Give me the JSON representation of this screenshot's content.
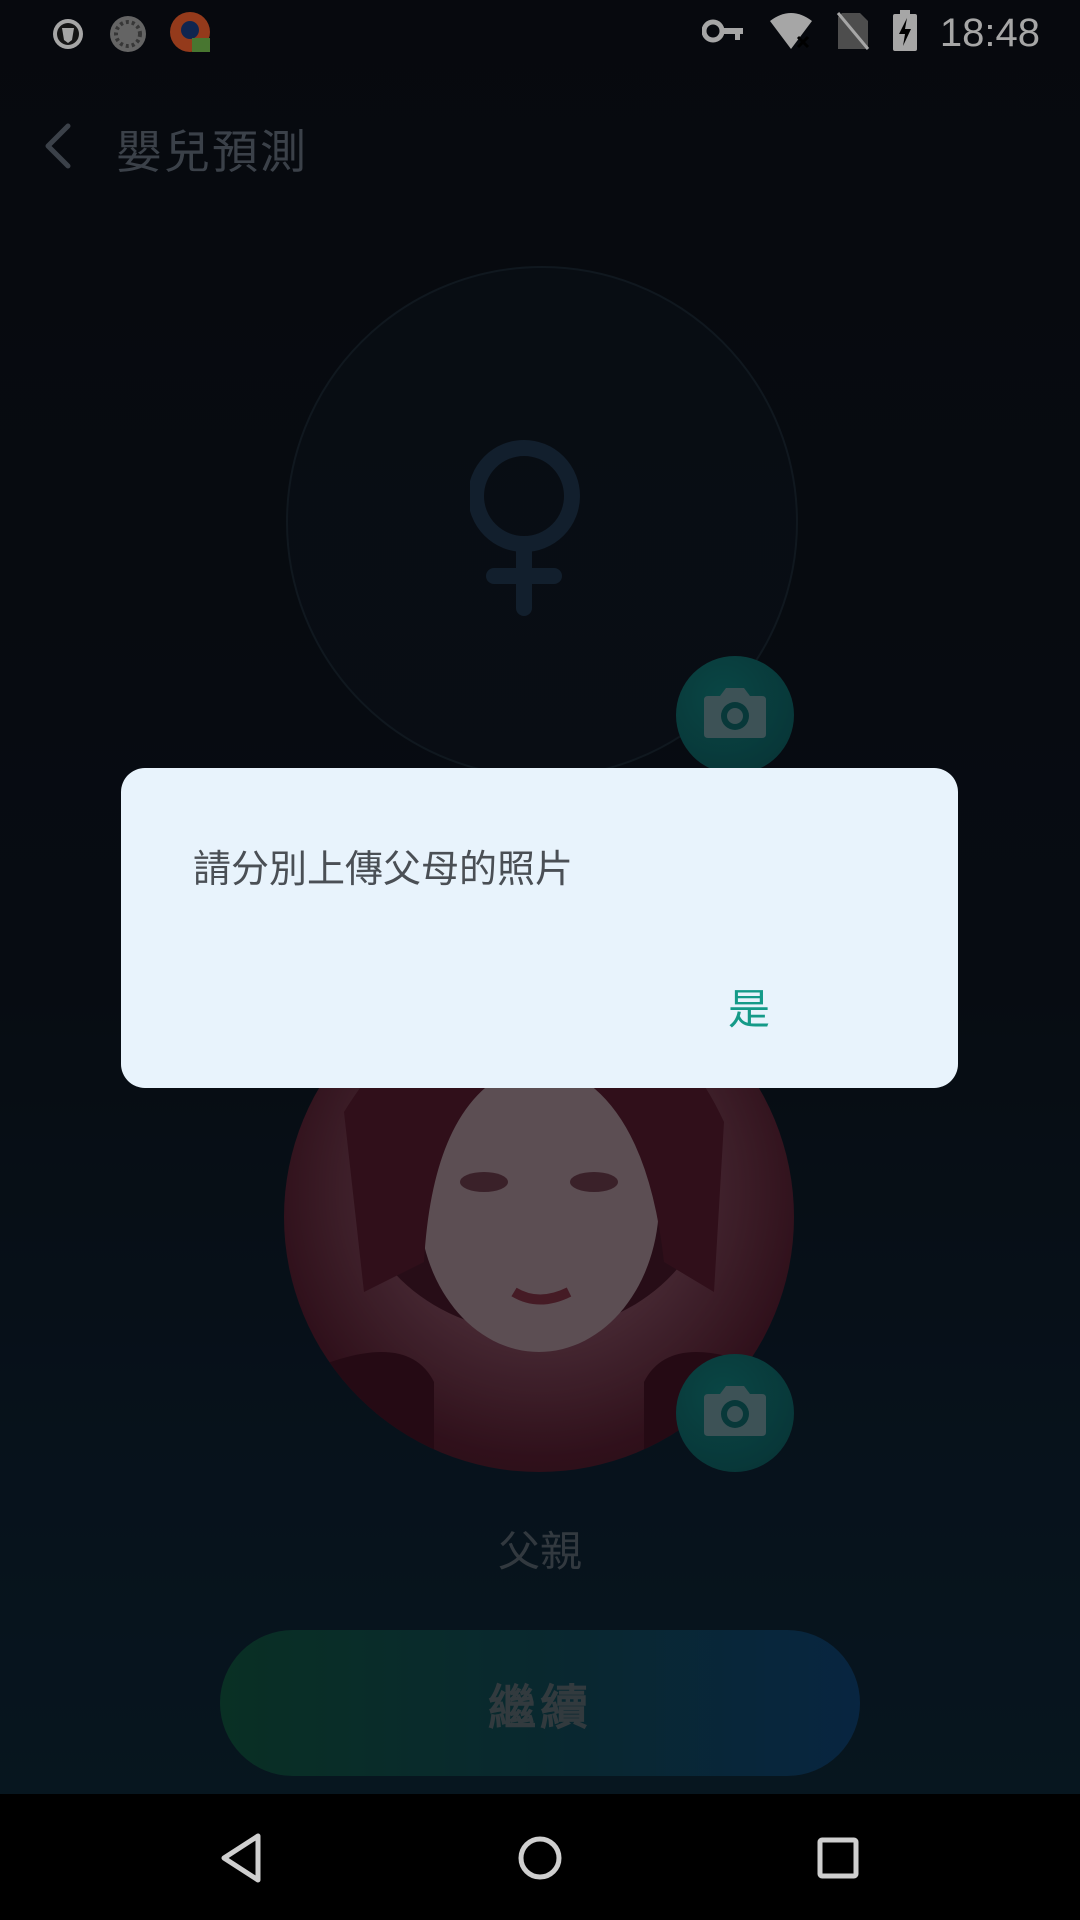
{
  "status_bar": {
    "time": "18:48",
    "icons": [
      "shield-notification-icon",
      "loading-notification-icon",
      "app-notification-icon",
      "vpn-key-icon",
      "wifi-off-icon",
      "no-sim-icon",
      "battery-charging-icon"
    ]
  },
  "app_bar": {
    "title": "嬰兒預測",
    "back_icon": "chevron-left-icon"
  },
  "mother_slot": {
    "icon": "female-symbol-icon",
    "camera_icon": "camera-icon"
  },
  "father_slot": {
    "label": "父親",
    "camera_icon": "camera-icon"
  },
  "continue_button": {
    "label": "繼續"
  },
  "dialog": {
    "message": "請分別上傳父母的照片",
    "ok_label": "是"
  },
  "nav_bar": {
    "icons": [
      "back-triangle-icon",
      "home-circle-icon",
      "recents-square-icon"
    ]
  },
  "colors": {
    "accent": "#149a88",
    "dialog_bg": "#e8f3fc",
    "background": "#0b0f16"
  }
}
